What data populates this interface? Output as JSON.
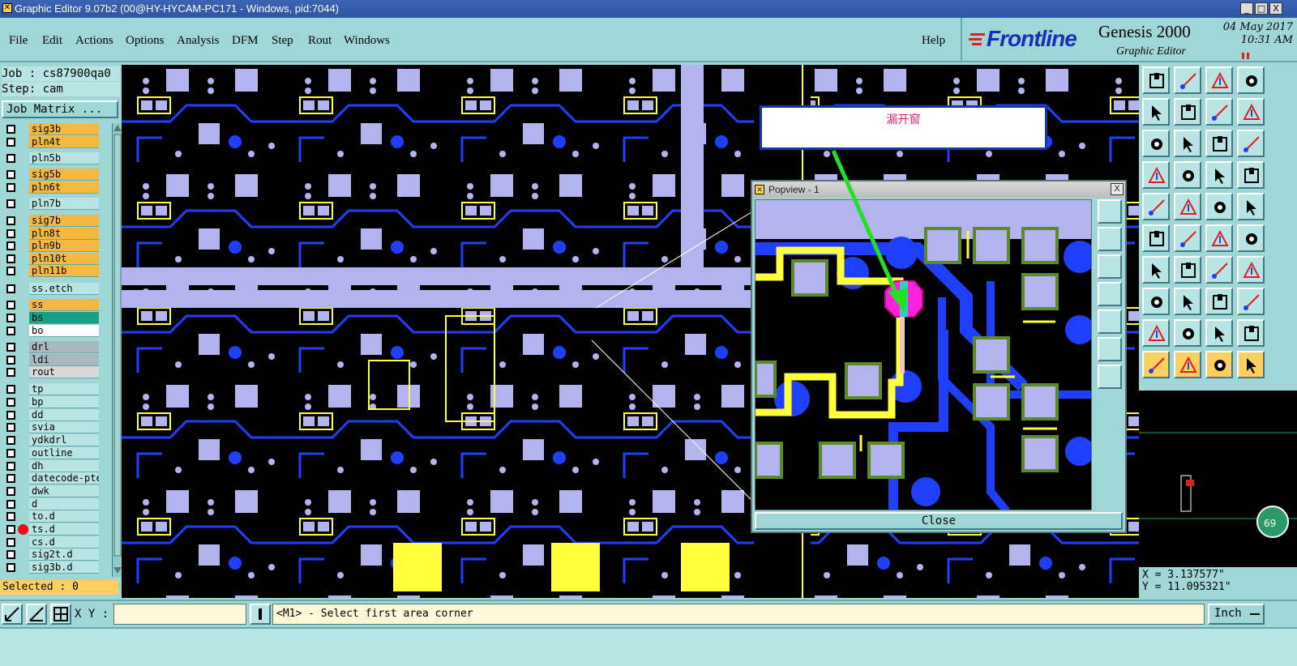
{
  "window": {
    "title": "Graphic Editor 9.07b2 (00@HY-HYCAM-PC171 - Windows, pid:7044)",
    "minimize": "_",
    "maximize": "□",
    "close": "X"
  },
  "menu": [
    "File",
    "Edit",
    "Actions",
    "Options",
    "Analysis",
    "DFM",
    "Step",
    "Rout",
    "Windows"
  ],
  "help": "Help",
  "brand": {
    "logo": "Frontline",
    "product": "Genesis 2000",
    "subtitle": "Graphic Editor",
    "date": "04 May 2017",
    "time": "10:31 AM"
  },
  "job": {
    "job_label": "Job : cs87900qa0",
    "step_label": "Step: cam",
    "matrix_button": "Job Matrix ..."
  },
  "layers": [
    {
      "name": "sig3b",
      "color": "#f5b942"
    },
    {
      "name": "pln4t",
      "color": "#f5b942"
    },
    {
      "name": "pln5b",
      "color": "#b8e4e4"
    },
    {
      "name": "sig5b",
      "color": "#f5b942"
    },
    {
      "name": "pln6t",
      "color": "#f5b942"
    },
    {
      "name": "pln7b",
      "color": "#b8e4e4"
    },
    {
      "name": "sig7b",
      "color": "#f5b942"
    },
    {
      "name": "pln8t",
      "color": "#f5b942"
    },
    {
      "name": "pln9b",
      "color": "#f5b942"
    },
    {
      "name": "pln10t",
      "color": "#f5b942"
    },
    {
      "name": "pln11b",
      "color": "#f5b942"
    },
    {
      "name": "ss.etch",
      "color": "#b8e4e4"
    },
    {
      "name": "ss",
      "color": "#f5b942"
    },
    {
      "name": "bs",
      "color": "#17a085"
    },
    {
      "name": "bo",
      "color": "#ffffff"
    },
    {
      "name": "drl",
      "color": "#a9b8be"
    },
    {
      "name": "ldi",
      "color": "#a9b8be"
    },
    {
      "name": "rout",
      "color": "#d8d8d8"
    },
    {
      "name": "tp",
      "color": "#b8e4e4"
    },
    {
      "name": "bp",
      "color": "#b8e4e4"
    },
    {
      "name": "dd",
      "color": "#b8e4e4"
    },
    {
      "name": "svia",
      "color": "#b8e4e4"
    },
    {
      "name": "ydkdrl",
      "color": "#b8e4e4"
    },
    {
      "name": "outline",
      "color": "#b8e4e4"
    },
    {
      "name": "dh",
      "color": "#b8e4e4"
    },
    {
      "name": "datecode-pte",
      "color": "#b8e4e4"
    },
    {
      "name": "dwk",
      "color": "#b8e4e4"
    },
    {
      "name": "d",
      "color": "#b8e4e4"
    },
    {
      "name": "to.d",
      "color": "#b8e4e4"
    },
    {
      "name": "ts.d",
      "color": "#b8e4e4"
    },
    {
      "name": "cs.d",
      "color": "#b8e4e4"
    },
    {
      "name": "sig2t.d",
      "color": "#b8e4e4"
    },
    {
      "name": "sig3b.d",
      "color": "#b8e4e4"
    }
  ],
  "selected": "Selected : 0",
  "popview": {
    "title": "Popview - 1",
    "close_button": "Close",
    "close_x": "X"
  },
  "annotation": "漏开窗",
  "coords": {
    "x": "X = 3.137577\"",
    "y": "Y = 11.095321\""
  },
  "bottom": {
    "xy_label": "X Y :",
    "xy_value": "",
    "message": "<M1> - Select first area corner",
    "unit": "Inch"
  },
  "zoom_badge": "69",
  "colors": {
    "pad": "#b3b3f0",
    "trace": "#1f3fff",
    "highlight": "#ffff3c",
    "defect": "#ff22dd",
    "annotation_arrow": "#22e022"
  }
}
